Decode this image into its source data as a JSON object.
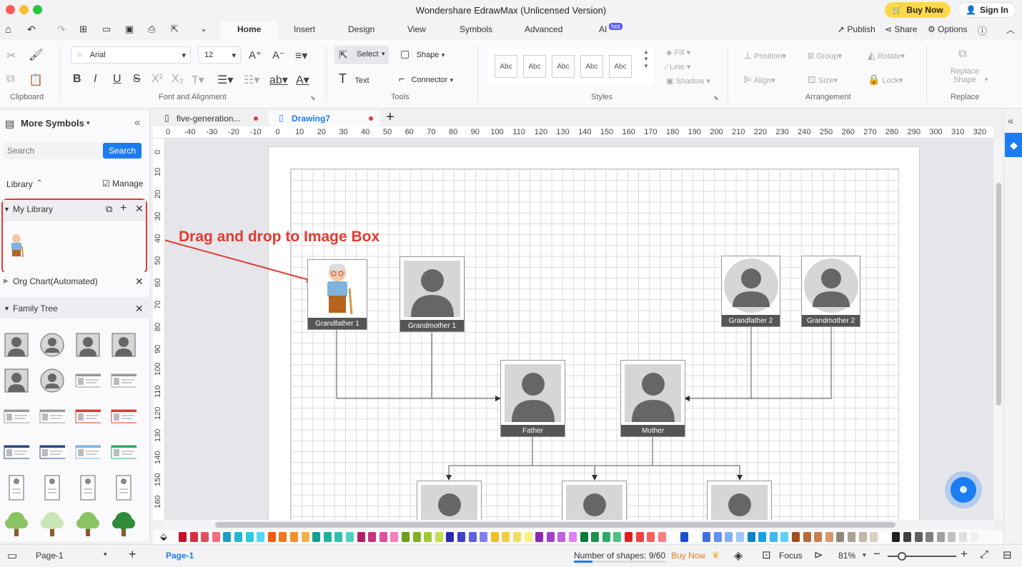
{
  "titlebar": {
    "title": "Wondershare EdrawMax (Unlicensed Version)",
    "buy_now": "Buy Now",
    "sign_in": "Sign In"
  },
  "menu": {
    "tabs": [
      "Home",
      "Insert",
      "Design",
      "View",
      "Symbols",
      "Advanced",
      "AI"
    ],
    "ai_badge": "hot",
    "publish": "Publish",
    "share": "Share",
    "options": "Options"
  },
  "ribbon": {
    "font_name": "Arial",
    "font_size": "12",
    "select": "Select",
    "shape": "Shape",
    "text": "Text",
    "connector": "Connector",
    "style_swatch": "Abc",
    "fill": "Fill",
    "line": "Line",
    "shadow": "Shadow",
    "position": "Position",
    "group": "Group",
    "rotate": "Rotate",
    "align": "Align",
    "size": "Size",
    "lock": "Lock",
    "replace_shape": "Replace Shape",
    "groups": {
      "clipboard": "Clipboard",
      "font": "Font and Alignment",
      "tools": "Tools",
      "styles": "Styles",
      "arrangement": "Arrangement",
      "replace": "Replace"
    }
  },
  "left_panel": {
    "title": "More Symbols",
    "search_placeholder": "Search",
    "search_button": "Search",
    "library_label": "Library",
    "manage_label": "Manage",
    "my_library": "My Library",
    "org_chart": "Org Chart(Automated)",
    "family_tree": "Family Tree"
  },
  "doc_tabs": [
    {
      "label": "five-generation..."
    },
    {
      "label": "Drawing7"
    }
  ],
  "ruler": {
    "h_ticks": [
      "0",
      "-40",
      "-30",
      "-20",
      "-10",
      "0",
      "10",
      "20",
      "30",
      "40",
      "50",
      "60",
      "70",
      "80",
      "90",
      "100",
      "110",
      "120",
      "130",
      "140",
      "150",
      "160",
      "170",
      "180",
      "190",
      "200",
      "210",
      "220",
      "230",
      "240",
      "250",
      "260",
      "270",
      "280",
      "290",
      "300",
      "310",
      "320"
    ],
    "v_ticks": [
      "0",
      "10",
      "20",
      "30",
      "40",
      "50",
      "60",
      "70",
      "80",
      "90",
      "100",
      "110",
      "120",
      "130",
      "140",
      "150",
      "160"
    ]
  },
  "annotation": "Drag and drop to Image Box",
  "diagram": {
    "people": [
      "Grandfather 1",
      "Grandmother 1",
      "Grandfather 2",
      "Grandmother 2",
      "Father",
      "Mother"
    ]
  },
  "colors": {
    "accent": "#1c7cf2",
    "annotation_red": "#e23a31",
    "label_bg": "#555555"
  },
  "statusbar": {
    "page_tab": "Page-1",
    "page_active": "Page-1",
    "shapes_count": "Number of shapes: 9/60",
    "buy_now": "Buy Now",
    "focus": "Focus",
    "zoom": "81%"
  }
}
